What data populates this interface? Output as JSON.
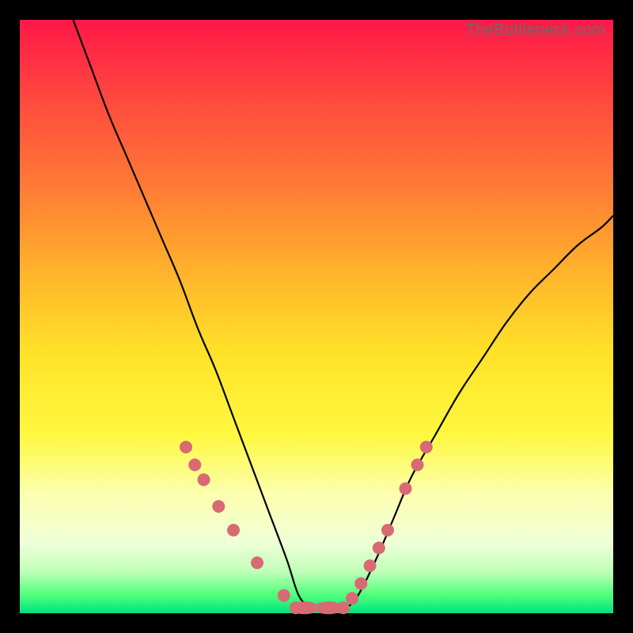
{
  "watermark": "TheBottleneck.com",
  "chart_data": {
    "type": "line",
    "title": "",
    "xlabel": "",
    "ylabel": "",
    "xlim": [
      0,
      100
    ],
    "ylim": [
      0,
      100
    ],
    "left_curve": {
      "x": [
        9,
        12,
        15,
        18,
        21,
        24,
        27,
        30,
        33,
        36,
        39,
        42,
        45,
        47,
        49
      ],
      "y": [
        100,
        92,
        84,
        77,
        70,
        63,
        56,
        48,
        41,
        33,
        25,
        17,
        9,
        3,
        0.8
      ]
    },
    "right_curve": {
      "x": [
        55,
        57,
        60,
        63,
        66,
        70,
        74,
        78,
        82,
        86,
        90,
        94,
        98,
        100
      ],
      "y": [
        0.8,
        3,
        9,
        16,
        23,
        30,
        37,
        43,
        49,
        54,
        58,
        62,
        65,
        67
      ]
    },
    "flat_segment": {
      "x": [
        47,
        55
      ],
      "y": [
        0.8,
        0.8
      ]
    },
    "marker_color": "#d86a74",
    "markers": [
      {
        "x": 28.0,
        "y": 28.0,
        "r": 8
      },
      {
        "x": 29.5,
        "y": 25.0,
        "r": 8
      },
      {
        "x": 31.0,
        "y": 22.5,
        "r": 8
      },
      {
        "x": 33.5,
        "y": 18.0,
        "r": 8
      },
      {
        "x": 36.0,
        "y": 14.0,
        "r": 8
      },
      {
        "x": 40.0,
        "y": 8.5,
        "r": 8
      },
      {
        "x": 44.5,
        "y": 3.0,
        "r": 8
      },
      {
        "x": 46.5,
        "y": 0.9,
        "r": 8
      },
      {
        "x": 48.0,
        "y": 0.9,
        "r": 8,
        "stretch": 2.3
      },
      {
        "x": 52.0,
        "y": 0.9,
        "r": 8,
        "stretch": 2.3
      },
      {
        "x": 54.5,
        "y": 0.9,
        "r": 8
      },
      {
        "x": 56.0,
        "y": 2.5,
        "r": 8
      },
      {
        "x": 57.5,
        "y": 5.0,
        "r": 8
      },
      {
        "x": 59.0,
        "y": 8.0,
        "r": 8
      },
      {
        "x": 60.5,
        "y": 11.0,
        "r": 8
      },
      {
        "x": 62.0,
        "y": 14.0,
        "r": 8
      },
      {
        "x": 65.0,
        "y": 21.0,
        "r": 8
      },
      {
        "x": 67.0,
        "y": 25.0,
        "r": 8
      },
      {
        "x": 68.5,
        "y": 28.0,
        "r": 8
      }
    ]
  }
}
